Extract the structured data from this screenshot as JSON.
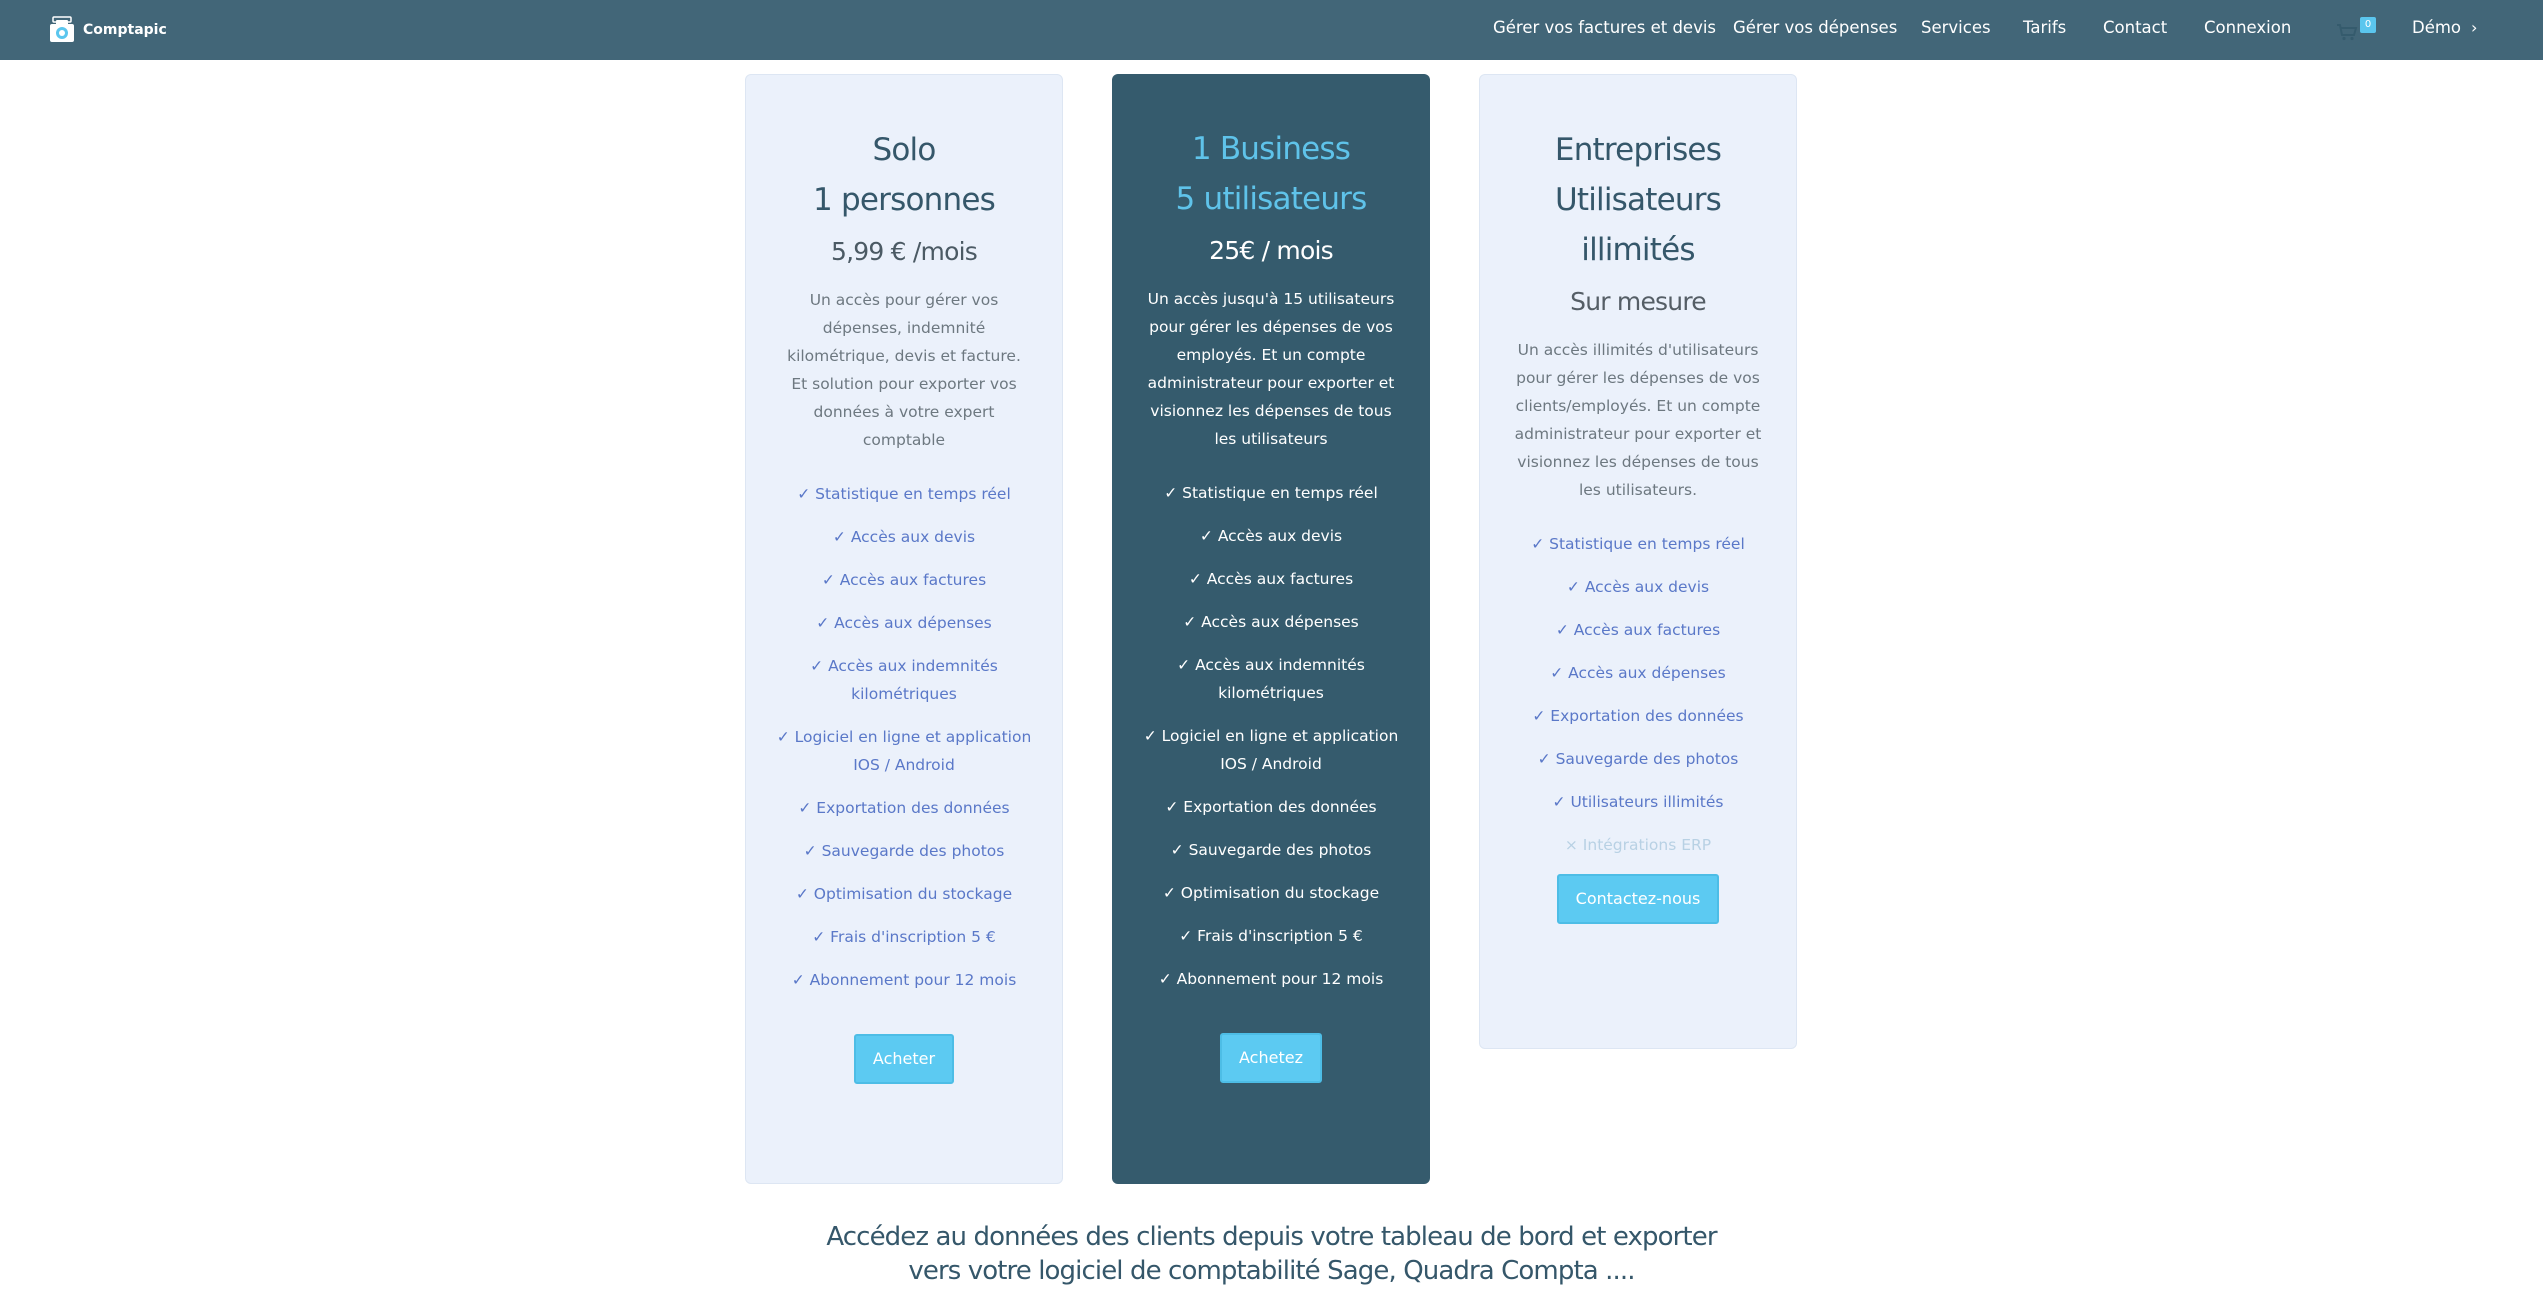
{
  "brand": {
    "name": "Comptapic"
  },
  "nav": {
    "items": [
      "Gérer vos factures et devis",
      "Gérer vos dépenses",
      "Services",
      "Tarifs",
      "Contact",
      "Connexion"
    ],
    "cart_count": "0",
    "demo_label": "Démo",
    "demo_chevron": "›"
  },
  "plans": [
    {
      "title_line1": "Solo",
      "title_line2": "1 personnes",
      "price": "5,99 € /mois",
      "description": "Un accès pour gérer vos dépenses, indemnité kilométrique, devis et facture. Et solution pour exporter vos données à votre expert comptable",
      "features": [
        "Statistique en temps réel",
        "Accès aux devis",
        "Accès aux factures",
        "Accès aux dépenses",
        "Accès aux indemnités kilométriques",
        "Logiciel en ligne et application IOS / Android",
        "Exportation des données",
        "Sauvegarde des photos",
        "Optimisation du stockage",
        "Frais d'inscription 5 €",
        "Abonnement pour 12 mois"
      ],
      "button": "Acheter"
    },
    {
      "title_line1": "1 Business",
      "title_line2": "5 utilisateurs",
      "price": "25€ / mois",
      "description": "Un accès jusqu'à 15 utilisateurs pour gérer les dépenses de vos employés. Et un compte administrateur pour exporter et visionnez les dépenses de tous les utilisateurs",
      "features": [
        "Statistique en temps réel",
        "Accès aux devis",
        "Accès aux factures",
        "Accès aux dépenses",
        "Accès aux indemnités kilométriques",
        "Logiciel en ligne et application IOS / Android",
        "Exportation des données",
        "Sauvegarde des photos",
        "Optimisation du stockage",
        "Frais d'inscription 5 €",
        "Abonnement pour 12 mois"
      ],
      "button": "Achetez"
    },
    {
      "title_line1": "Entreprises",
      "title_line2": "Utilisateurs",
      "title_line3": "illimités",
      "price": "Sur mesure",
      "description": "Un accès illimités d'utilisateurs pour gérer les dépenses de vos clients/employés. Et un compte administrateur pour exporter et visionnez les dépenses de tous les utilisateurs.",
      "features": [
        "Statistique en temps réel",
        "Accès aux devis",
        "Accès aux factures",
        "Accès aux dépenses",
        "Exportation des données",
        "Sauvegarde des photos",
        "Utilisateurs illimités"
      ],
      "disabled_feature": "Intégrations ERP",
      "button": "Contactez-nous"
    }
  ],
  "marks": {
    "check": "✓",
    "cross": "×"
  },
  "bottom": {
    "line1": "Accédez au données des clients depuis votre tableau de bord et exporter",
    "line2": "vers votre logiciel de comptabilité Sage, Quadra Compta ...."
  }
}
